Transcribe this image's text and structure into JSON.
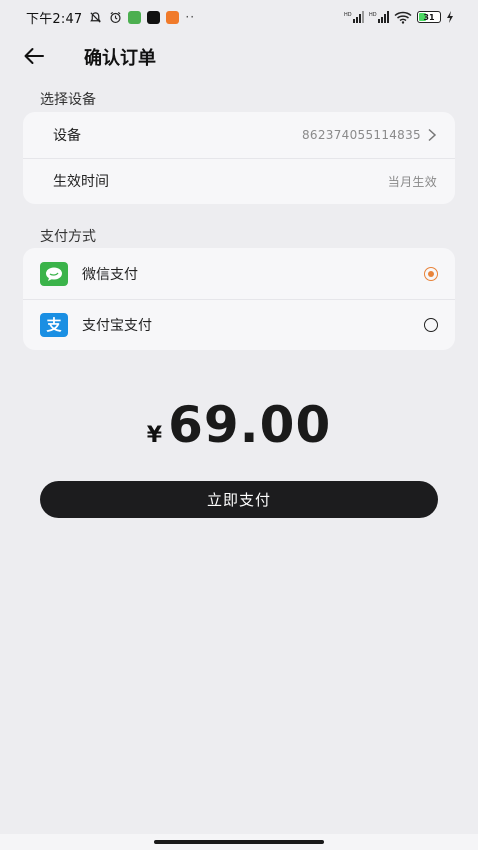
{
  "status_bar": {
    "time": "下午2:47",
    "network_labels": [
      "HD",
      "HD"
    ],
    "battery": "31"
  },
  "header": {
    "title": "确认订单"
  },
  "device_section": {
    "label": "选择设备",
    "device_label": "设备",
    "device_value": "862374055114835",
    "effective_label": "生效时间",
    "effective_value": "当月生效"
  },
  "payment_section": {
    "label": "支付方式",
    "options": [
      {
        "label": "微信支付",
        "icon": "wechat-pay-icon",
        "selected": true
      },
      {
        "label": "支付宝支付",
        "icon": "alipay-icon",
        "icon_text": "支",
        "selected": false
      }
    ]
  },
  "price": {
    "symbol": "¥",
    "amount": "69.00"
  },
  "pay_button": {
    "label": "立即支付"
  },
  "colors": {
    "accent": "#e8833a",
    "button_bg": "#1c1c1e",
    "wechat": "#3bb34a",
    "alipay": "#1a8fe3"
  }
}
